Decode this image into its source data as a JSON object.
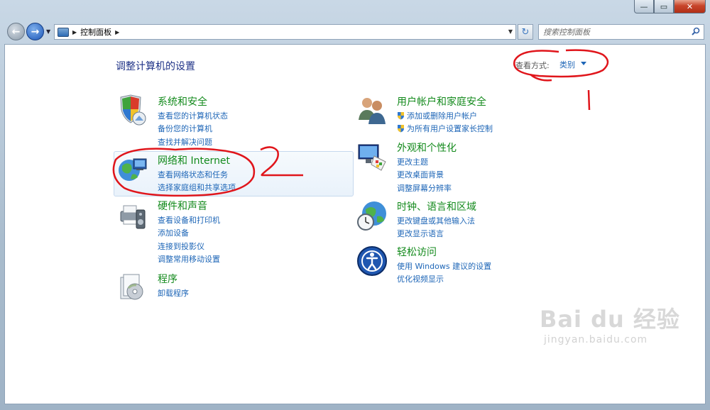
{
  "window": {
    "minimize_glyph": "—",
    "maximize_glyph": "▭",
    "close_glyph": "✕"
  },
  "nav": {
    "back_glyph": "←",
    "forward_glyph": "→",
    "recent_glyph": "▼"
  },
  "address": {
    "crumb": "控制面板",
    "separator": "▶",
    "dropdown_glyph": "▼",
    "refresh_glyph": "↻"
  },
  "search": {
    "placeholder": "搜索控制面板"
  },
  "main": {
    "title": "调整计算机的设置",
    "view_by_label": "查看方式:",
    "view_by_value": "类别"
  },
  "categories": [
    {
      "title": "系统和安全",
      "icon": "shield-icon",
      "links": [
        "查看您的计算机状态",
        "备份您的计算机",
        "查找并解决问题"
      ]
    },
    {
      "title": "网络和 Internet",
      "icon": "network-icon",
      "links": [
        "查看网络状态和任务",
        "选择家庭组和共享选项"
      ]
    },
    {
      "title": "硬件和声音",
      "icon": "printer-icon",
      "links": [
        "查看设备和打印机",
        "添加设备",
        "连接到投影仪",
        "调整常用移动设置"
      ]
    },
    {
      "title": "程序",
      "icon": "programs-icon",
      "links": [
        "卸载程序"
      ]
    },
    {
      "title": "用户帐户和家庭安全",
      "icon": "users-icon",
      "links": [
        "添加或删除用户帐户",
        "为所有用户设置家长控制"
      ]
    },
    {
      "title": "外观和个性化",
      "icon": "appearance-icon",
      "links": [
        "更改主题",
        "更改桌面背景",
        "调整屏幕分辨率"
      ]
    },
    {
      "title": "时钟、语言和区域",
      "icon": "clock-globe-icon",
      "links": [
        "更改键盘或其他输入法",
        "更改显示语言"
      ]
    },
    {
      "title": "轻松访问",
      "icon": "ease-of-access-icon",
      "links": [
        "使用 Windows 建议的设置",
        "优化视频显示"
      ]
    }
  ],
  "annotations": {
    "label_1": "1",
    "label_2": "2",
    "color": "#e0151b"
  },
  "watermark": {
    "brand": "Bai du 经验",
    "url": "jingyan.baidu.com"
  },
  "colors": {
    "link": "#1e66b7",
    "category_title": "#138a1c",
    "page_title": "#1e3287"
  }
}
